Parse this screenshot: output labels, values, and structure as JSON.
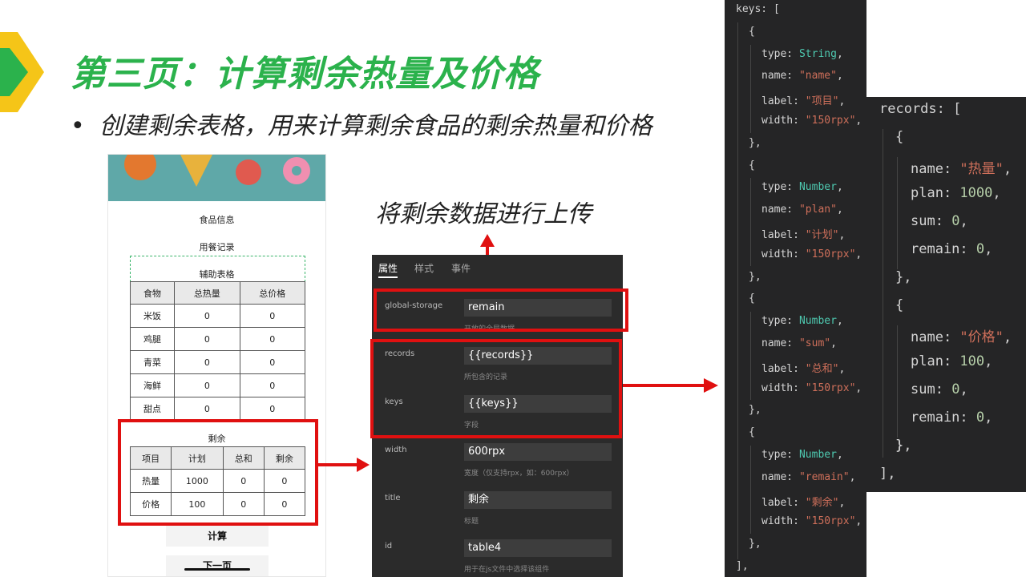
{
  "title": "第三页：计算剩余热量及价格",
  "bullet": "创建剩余表格，用来计算剩余食品的剩余热量和价格",
  "upload_label": "将剩余数据进行上传",
  "phone": {
    "food_info": "食品信息",
    "meal_record": "用餐记录",
    "aux_table_title": "辅助表格",
    "aux_headers": [
      "食物",
      "总热量",
      "总价格"
    ],
    "aux_rows": [
      [
        "米饭",
        "0",
        "0"
      ],
      [
        "鸡腿",
        "0",
        "0"
      ],
      [
        "青菜",
        "0",
        "0"
      ],
      [
        "海鲜",
        "0",
        "0"
      ],
      [
        "甜点",
        "0",
        "0"
      ]
    ],
    "remain_title": "剩余",
    "remain_headers": [
      "项目",
      "计划",
      "总和",
      "剩余"
    ],
    "remain_rows": [
      [
        "热量",
        "1000",
        "0",
        "0"
      ],
      [
        "价格",
        "100",
        "0",
        "0"
      ]
    ],
    "calc_button": "计算",
    "next_button": "下一页"
  },
  "panel": {
    "tabs": [
      "属性",
      "样式",
      "事件"
    ],
    "props": [
      {
        "label": "global-storage",
        "value": "remain",
        "hint": "开放的全局数据"
      },
      {
        "label": "records",
        "value": "{{records}}",
        "hint": "所包含的记录"
      },
      {
        "label": "keys",
        "value": "{{keys}}",
        "hint": "字段"
      },
      {
        "label": "width",
        "value": "600rpx",
        "hint": "宽度（仅支持rpx，如：600rpx）"
      },
      {
        "label": "title",
        "value": "剩余",
        "hint": "标题"
      },
      {
        "label": "id",
        "value": "table4",
        "hint": "用于在js文件中选择该组件"
      }
    ]
  },
  "keys_code": {
    "header": "keys: [",
    "items": [
      {
        "type": "String",
        "name": "\"name\"",
        "label": "\"项目\"",
        "width": "\"150rpx\""
      },
      {
        "type": "Number",
        "name": "\"plan\"",
        "label": "\"计划\"",
        "width": "\"150rpx\""
      },
      {
        "type": "Number",
        "name": "\"sum\"",
        "label": "\"总和\"",
        "width": "\"150rpx\""
      },
      {
        "type": "Number",
        "name": "\"remain\"",
        "label": "\"剩余\"",
        "width": "\"150rpx\""
      }
    ],
    "footer": "],"
  },
  "records_code": {
    "header": "records: [",
    "items": [
      {
        "name": "\"热量\"",
        "plan": "1000",
        "sum": "0",
        "remain": "0"
      },
      {
        "name": "\"价格\"",
        "plan": "100",
        "sum": "0",
        "remain": "0"
      }
    ],
    "footer": "],"
  },
  "colors": {
    "title_green": "#2bb24c",
    "highlight_red": "#e01010",
    "arrow_yellow": "#f5c518"
  }
}
